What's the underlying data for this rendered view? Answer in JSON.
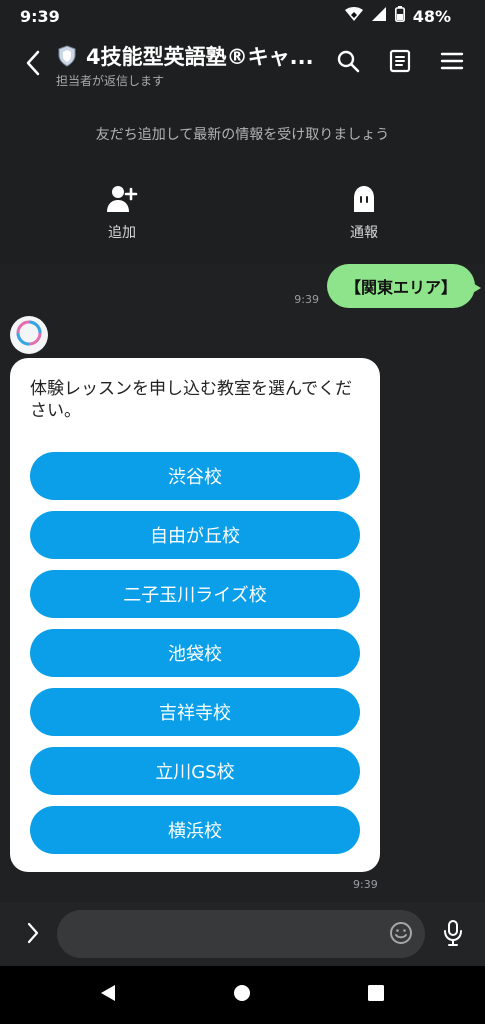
{
  "status": {
    "time": "9:39",
    "battery": "48%"
  },
  "header": {
    "title": "4技能型英語塾®キャ...",
    "subtitle": "担当者が返信します"
  },
  "notice": {
    "text": "友だち追加して最新の情報を受け取りましょう",
    "add_label": "追加",
    "report_label": "通報"
  },
  "messages": {
    "outgoing": {
      "text": "【関東エリア】",
      "time": "9:39"
    },
    "incoming": {
      "prompt": "体験レッスンを申し込む教室を選んでください。",
      "time": "9:39",
      "options": [
        "渋谷校",
        "自由が丘校",
        "二子玉川ライズ校",
        "池袋校",
        "吉祥寺校",
        "立川GS校",
        "横浜校"
      ]
    }
  },
  "input": {
    "placeholder": ""
  },
  "colors": {
    "accent": "#0a9fe8",
    "bubble": "#8de48a",
    "background": "#1f2021"
  }
}
